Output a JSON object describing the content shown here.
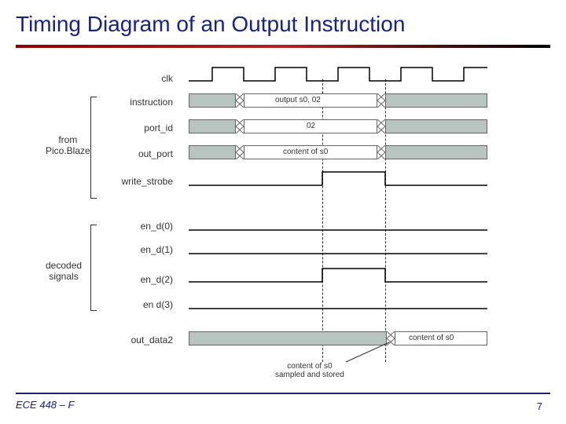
{
  "title": "Timing Diagram of an Output Instruction",
  "footer": "ECE 448 – F",
  "page_number": "7",
  "group_labels": {
    "from_picoblaze": "from\nPico.Blaze",
    "decoded_signals": "decoded\nsignals"
  },
  "signals": {
    "clk": "clk",
    "instruction": "instruction",
    "port_id": "port_id",
    "out_port": "out_port",
    "write_strobe": "write_strobe",
    "en_d0": "en_d(0)",
    "en_d1": "en_d(1)",
    "en_d2": "en_d(2)",
    "en_d3": "en d(3)",
    "out_data2": "out_data2"
  },
  "bus_labels": {
    "instruction_val": "output s0, 02",
    "port_id_val": "02",
    "out_port_val": "content of s0",
    "out_data2_val": "content of s0"
  },
  "annotation": "content of s0\nsampled and stored",
  "chart_data": {
    "type": "timing_diagram",
    "clock_periods": 5,
    "signals": [
      {
        "name": "clk",
        "type": "clock",
        "pattern": "10101010"
      },
      {
        "name": "instruction",
        "type": "bus",
        "segments": [
          {
            "start": 0,
            "end": 1.2,
            "value": ""
          },
          {
            "start": 1.2,
            "end": 3.2,
            "value": "output s0, 02"
          },
          {
            "start": 3.2,
            "end": 5,
            "value": ""
          }
        ]
      },
      {
        "name": "port_id",
        "type": "bus",
        "segments": [
          {
            "start": 0,
            "end": 1.2,
            "value": ""
          },
          {
            "start": 1.2,
            "end": 3.2,
            "value": "02"
          },
          {
            "start": 3.2,
            "end": 5,
            "value": ""
          }
        ]
      },
      {
        "name": "out_port",
        "type": "bus",
        "segments": [
          {
            "start": 0,
            "end": 1.2,
            "value": ""
          },
          {
            "start": 1.2,
            "end": 3.2,
            "value": "content of s0"
          },
          {
            "start": 3.2,
            "end": 5,
            "value": ""
          }
        ]
      },
      {
        "name": "write_strobe",
        "type": "digital",
        "transitions": [
          {
            "time": 0,
            "level": 0
          },
          {
            "time": 2.2,
            "level": 1
          },
          {
            "time": 3.2,
            "level": 0
          }
        ]
      },
      {
        "name": "en_d(0)",
        "type": "digital",
        "transitions": [
          {
            "time": 0,
            "level": 0
          }
        ]
      },
      {
        "name": "en_d(1)",
        "type": "digital",
        "transitions": [
          {
            "time": 0,
            "level": 0
          }
        ]
      },
      {
        "name": "en_d(2)",
        "type": "digital",
        "transitions": [
          {
            "time": 0,
            "level": 0
          },
          {
            "time": 2.2,
            "level": 1
          },
          {
            "time": 3.2,
            "level": 0
          }
        ]
      },
      {
        "name": "en d(3)",
        "type": "digital",
        "transitions": [
          {
            "time": 0,
            "level": 0
          }
        ]
      },
      {
        "name": "out_data2",
        "type": "bus",
        "segments": [
          {
            "start": 0,
            "end": 3.3,
            "value": ""
          },
          {
            "start": 3.3,
            "end": 5,
            "value": "content of s0"
          }
        ]
      }
    ],
    "vertical_markers": [
      2.2,
      3.2
    ]
  }
}
